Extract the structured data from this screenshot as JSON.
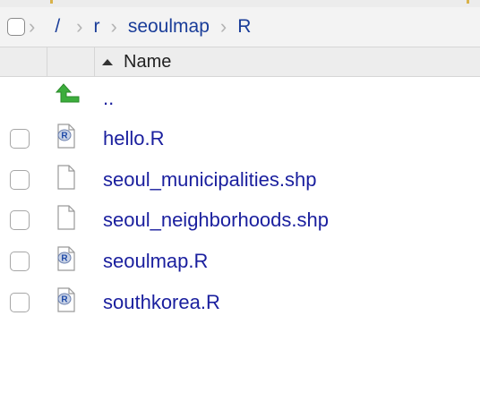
{
  "breadcrumb": {
    "root": "/",
    "items": [
      "r",
      "seoulmap",
      "R"
    ]
  },
  "header": {
    "name_label": "Name",
    "sort": "ascending"
  },
  "files": [
    {
      "label": "..",
      "icon": "up-arrow-icon",
      "checkbox": false
    },
    {
      "label": "hello.R",
      "icon": "r-file-icon",
      "checkbox": true
    },
    {
      "label": "seoul_municipalities.shp",
      "icon": "blank-file-icon",
      "checkbox": true
    },
    {
      "label": "seoul_neighborhoods.shp",
      "icon": "blank-file-icon",
      "checkbox": true
    },
    {
      "label": "seoulmap.R",
      "icon": "r-file-icon",
      "checkbox": true
    },
    {
      "label": "southkorea.R",
      "icon": "r-file-icon",
      "checkbox": true
    }
  ],
  "colors": {
    "link": "#1a1f9e",
    "breadcrumb_link": "#1a3d99",
    "up_arrow": "#3cad3c"
  }
}
